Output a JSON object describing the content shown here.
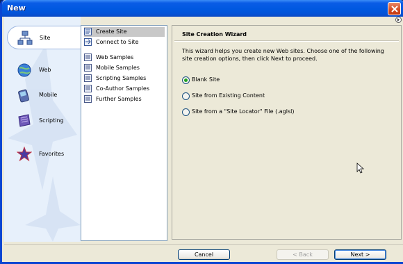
{
  "window": {
    "title": "New"
  },
  "categories": [
    {
      "label": "Site",
      "icon": "sitemap-icon",
      "selected": true
    },
    {
      "label": "Web",
      "icon": "globe-icon",
      "selected": false
    },
    {
      "label": "Mobile",
      "icon": "mobile-icon",
      "selected": false
    },
    {
      "label": "Scripting",
      "icon": "scroll-icon",
      "selected": false
    },
    {
      "label": "Favorites",
      "icon": "star-icon",
      "selected": false
    }
  ],
  "list": {
    "items": [
      {
        "label": "Create Site",
        "selected": true
      },
      {
        "label": "Connect to Site",
        "selected": false
      },
      {
        "label": "Web Samples",
        "selected": false
      },
      {
        "label": "Mobile Samples",
        "selected": false
      },
      {
        "label": "Scripting Samples",
        "selected": false
      },
      {
        "label": "Co-Author Samples",
        "selected": false
      },
      {
        "label": "Further Samples",
        "selected": false
      }
    ]
  },
  "wizard": {
    "title": "Site Creation Wizard",
    "description": "This wizard helps you create new Web sites. Choose one of the following site creation options, then click Next to proceed.",
    "options": [
      {
        "label": "Blank Site",
        "checked": true
      },
      {
        "label": "Site from Existing Content",
        "checked": false
      },
      {
        "label": "Site from a \"Site Locator\" File (.aglsl)",
        "checked": false
      }
    ]
  },
  "buttons": {
    "cancel": "Cancel",
    "back": "< Back",
    "next": "Next >"
  },
  "colors": {
    "titlebar": "#0058e0",
    "left_panel": "#e7f0fb",
    "dialog": "#ece9d8",
    "radio_dot": "#21a121"
  }
}
